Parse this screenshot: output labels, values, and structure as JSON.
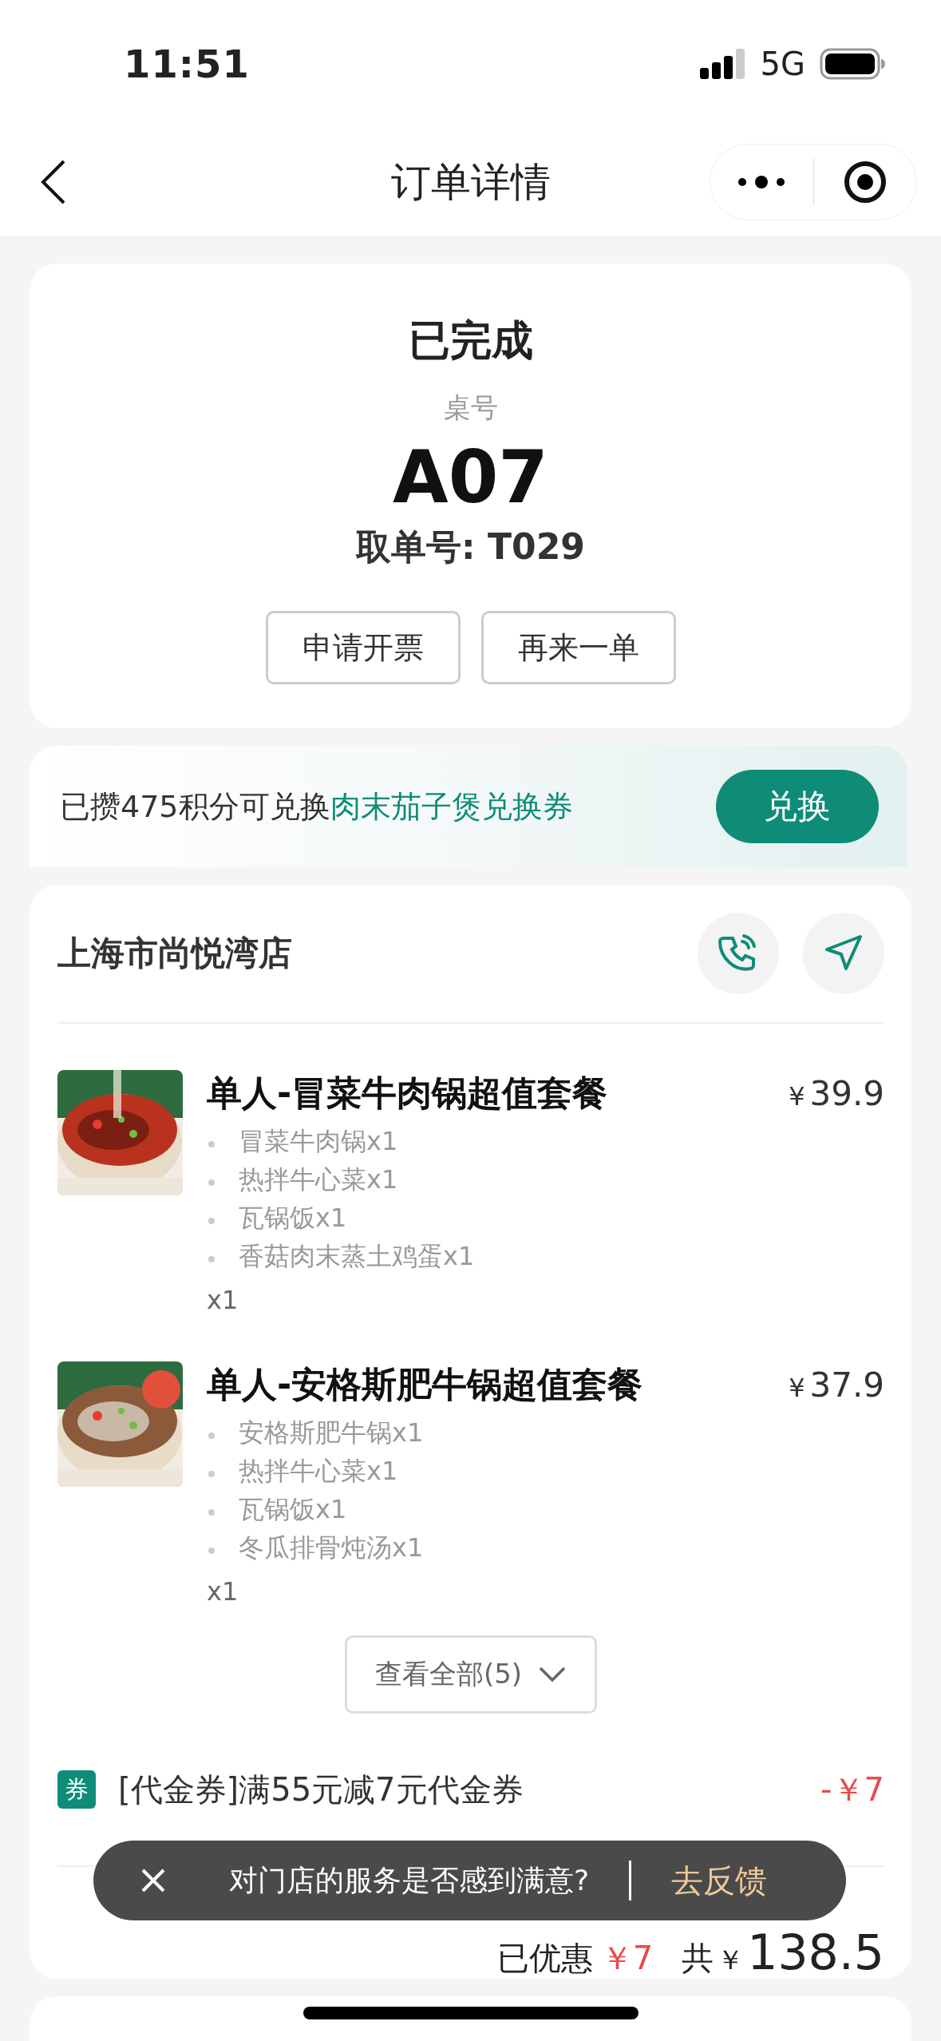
{
  "status_bar": {
    "time": "11:51",
    "network": "5G"
  },
  "nav": {
    "title": "订单详情"
  },
  "order": {
    "status": "已完成",
    "table_label": "桌号",
    "table_number": "A07",
    "pickup": "取单号: T029",
    "actions": [
      "申请开票",
      "再来一单"
    ]
  },
  "points": {
    "text": "已攒475积分可兑换",
    "reward": "肉末茄子煲兑换券",
    "button": "兑换"
  },
  "store": {
    "name": "上海市尚悦湾店",
    "items": [
      {
        "name": "单人-冒菜牛肉锅超值套餐",
        "currency": "¥",
        "price": "39.9",
        "components": [
          "冒菜牛肉锅x1",
          "热拌牛心菜x1",
          "瓦锅饭x1",
          "香菇肉末蒸土鸡蛋x1"
        ],
        "quantity": "x1"
      },
      {
        "name": "单人-安格斯肥牛锅超值套餐",
        "currency": "¥",
        "price": "37.9",
        "components": [
          "安格斯肥牛锅x1",
          "热拌牛心菜x1",
          "瓦锅饭x1",
          "冬瓜排骨炖汤x1"
        ],
        "quantity": "x1"
      }
    ],
    "view_all": "查看全部(5)",
    "coupon": {
      "badge": "券",
      "text": "[代金券]满55元减7元代金券",
      "amount": "-￥7"
    },
    "summary": {
      "discount_label": "已优惠",
      "discount": "￥7",
      "total_label": "共",
      "currency": "￥",
      "total": "138.5"
    }
  },
  "toast": {
    "text": "对门店的服务是否感到满意?",
    "action": "去反馈"
  }
}
